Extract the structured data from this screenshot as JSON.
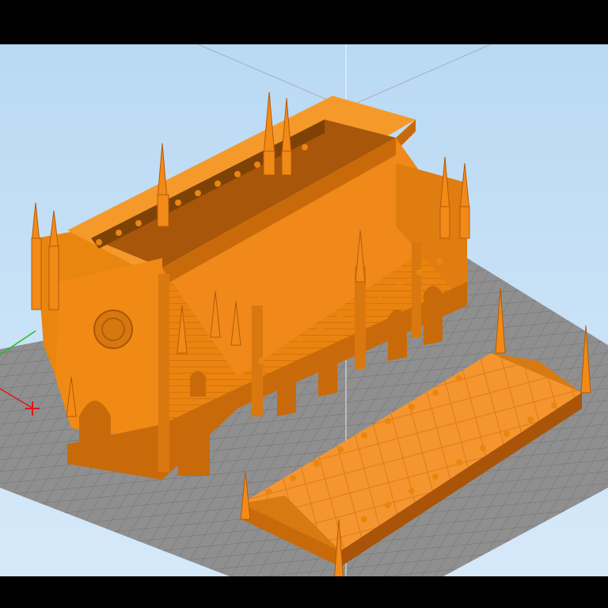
{
  "app": {
    "view": "3d-build-plate-viewport",
    "background": "#c5dff5"
  },
  "scene": {
    "bed_color": "#8c8c8c",
    "grid_color": "#5f5f5f",
    "model_color": "#f28a17",
    "model_shade": "#c96a0a",
    "model_dark": "#a95408",
    "objects": [
      "cathedral-nave-body",
      "cathedral-roof-section"
    ]
  },
  "axes": {
    "x_color": "#e01818",
    "y_color": "#1fbf1f",
    "z_color": "#7a7a7a"
  }
}
